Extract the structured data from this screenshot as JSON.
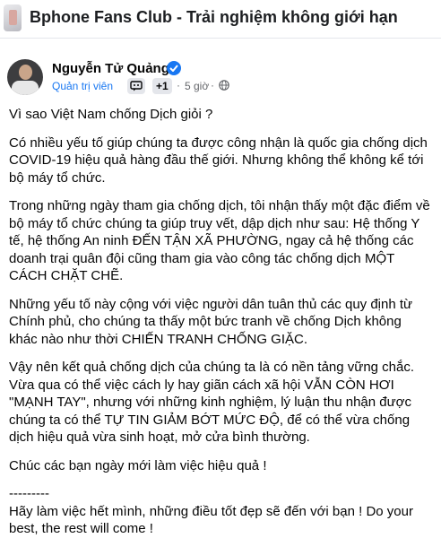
{
  "group": {
    "title": "Bphone Fans Club - Trải nghiệm không giới hạn"
  },
  "post": {
    "author": "Nguyễn Tử Quảng",
    "role": "Quản trị viên",
    "badge_count": "+1",
    "time": "5 giờ",
    "separator": "·",
    "paragraphs": [
      "Vì sao Việt Nam chống Dịch giỏi ?",
      "Có nhiều yếu tố giúp chúng ta được công nhận là quốc gia chống dịch COVID-19 hiệu quả hàng đầu thế giới. Nhưng không thể không kể tới bộ máy tổ chức.",
      "Trong những ngày tham gia chống dịch, tôi nhận thấy một đặc điểm về bộ máy tổ chức chúng ta giúp truy vết, dập dịch như sau: Hệ thống Y tế, hệ thống An ninh ĐẾN TẬN XÃ PHƯỜNG, ngay cả hệ thống các doanh trại quân đội cũng tham gia vào công tác chống dịch MỘT CÁCH CHẶT CHẼ.",
      "Những yếu tố này cộng với việc người dân tuân thủ các quy định từ Chính phủ, cho chúng ta thấy một bức tranh về chống Dịch không khác nào như thời CHIẾN TRANH CHỐNG GIẶC.",
      "Vậy nên kết quả chống dịch của chúng ta là có nền tảng vững chắc. Vừa qua có thể việc cách ly hay giãn cách xã hội VẪN CÒN HƠI \"MẠNH TAY\", nhưng với những kinh nghiệm, lý luận thu nhận được chúng ta có thể TỰ TIN GIẢM BỚT MỨC ĐỘ, để có thể vừa chống dịch hiệu quả vừa sinh hoạt, mở cửa bình thường.",
      "Chúc các bạn ngày mới làm việc hiệu quả !"
    ],
    "divider": "---------",
    "closing": "Hãy làm việc hết mình, những điều tốt đẹp sẽ đến với bạn ! Do your best, the rest will come !"
  },
  "colors": {
    "accent": "#1877f2",
    "secondary_text": "#65676b",
    "badge_bg": "#e4e6eb"
  },
  "icons": {
    "verified": "verified-badge-icon",
    "group_badge": "chat-badge-icon",
    "privacy": "globe-icon"
  }
}
